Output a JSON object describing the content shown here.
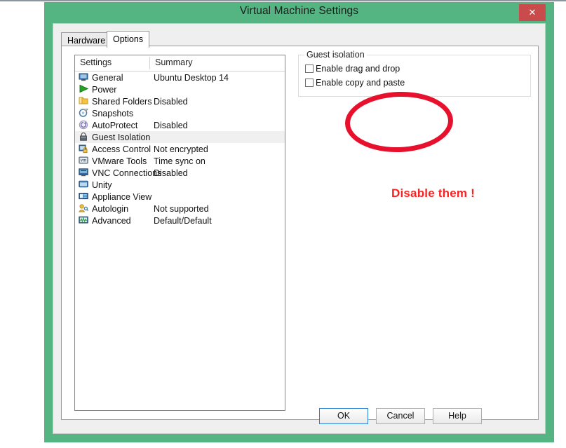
{
  "window": {
    "title": "Virtual Machine Settings",
    "close_label": "✕",
    "close_icon": "close-icon",
    "titlebar_color": "#54b482",
    "close_color": "#ca4b4b"
  },
  "tabs": [
    {
      "label": "Hardware",
      "active": false
    },
    {
      "label": "Options",
      "active": true
    }
  ],
  "settings_list": {
    "columns": [
      "Settings",
      "Summary"
    ],
    "rows": [
      {
        "icon": "monitor-icon",
        "label": "General",
        "summary": "Ubuntu Desktop 14",
        "selected": false
      },
      {
        "icon": "play-triangle-icon",
        "label": "Power",
        "summary": "",
        "selected": false
      },
      {
        "icon": "folder-icon",
        "label": "Shared Folders",
        "summary": "Disabled",
        "selected": false
      },
      {
        "icon": "camera-icon",
        "label": "Snapshots",
        "summary": "",
        "selected": false
      },
      {
        "icon": "autoprotect-icon",
        "label": "AutoProtect",
        "summary": "Disabled",
        "selected": false
      },
      {
        "icon": "lock-icon",
        "label": "Guest Isolation",
        "summary": "",
        "selected": true
      },
      {
        "icon": "access-control-icon",
        "label": "Access Control",
        "summary": "Not encrypted",
        "selected": false
      },
      {
        "icon": "vmware-tools-icon",
        "label": "VMware Tools",
        "summary": "Time sync on",
        "selected": false
      },
      {
        "icon": "vnc-icon",
        "label": "VNC Connections",
        "summary": "Disabled",
        "selected": false
      },
      {
        "icon": "unity-icon",
        "label": "Unity",
        "summary": "",
        "selected": false
      },
      {
        "icon": "appliance-icon",
        "label": "Appliance View",
        "summary": "",
        "selected": false
      },
      {
        "icon": "autologin-icon",
        "label": "Autologin",
        "summary": "Not supported",
        "selected": false
      },
      {
        "icon": "advanced-icon",
        "label": "Advanced",
        "summary": "Default/Default",
        "selected": false
      }
    ]
  },
  "guest_isolation": {
    "legend": "Guest isolation",
    "checkboxes": [
      {
        "label": "Enable drag and drop",
        "checked": false
      },
      {
        "label": "Enable copy and paste",
        "checked": false
      }
    ]
  },
  "annotations": {
    "ellipse_color": "#e8112d",
    "callout_text": "Disable them !",
    "callout_color": "#fc2020"
  },
  "buttons": {
    "ok": "OK",
    "cancel": "Cancel",
    "help": "Help",
    "default_accent": "#2a7ed2"
  }
}
